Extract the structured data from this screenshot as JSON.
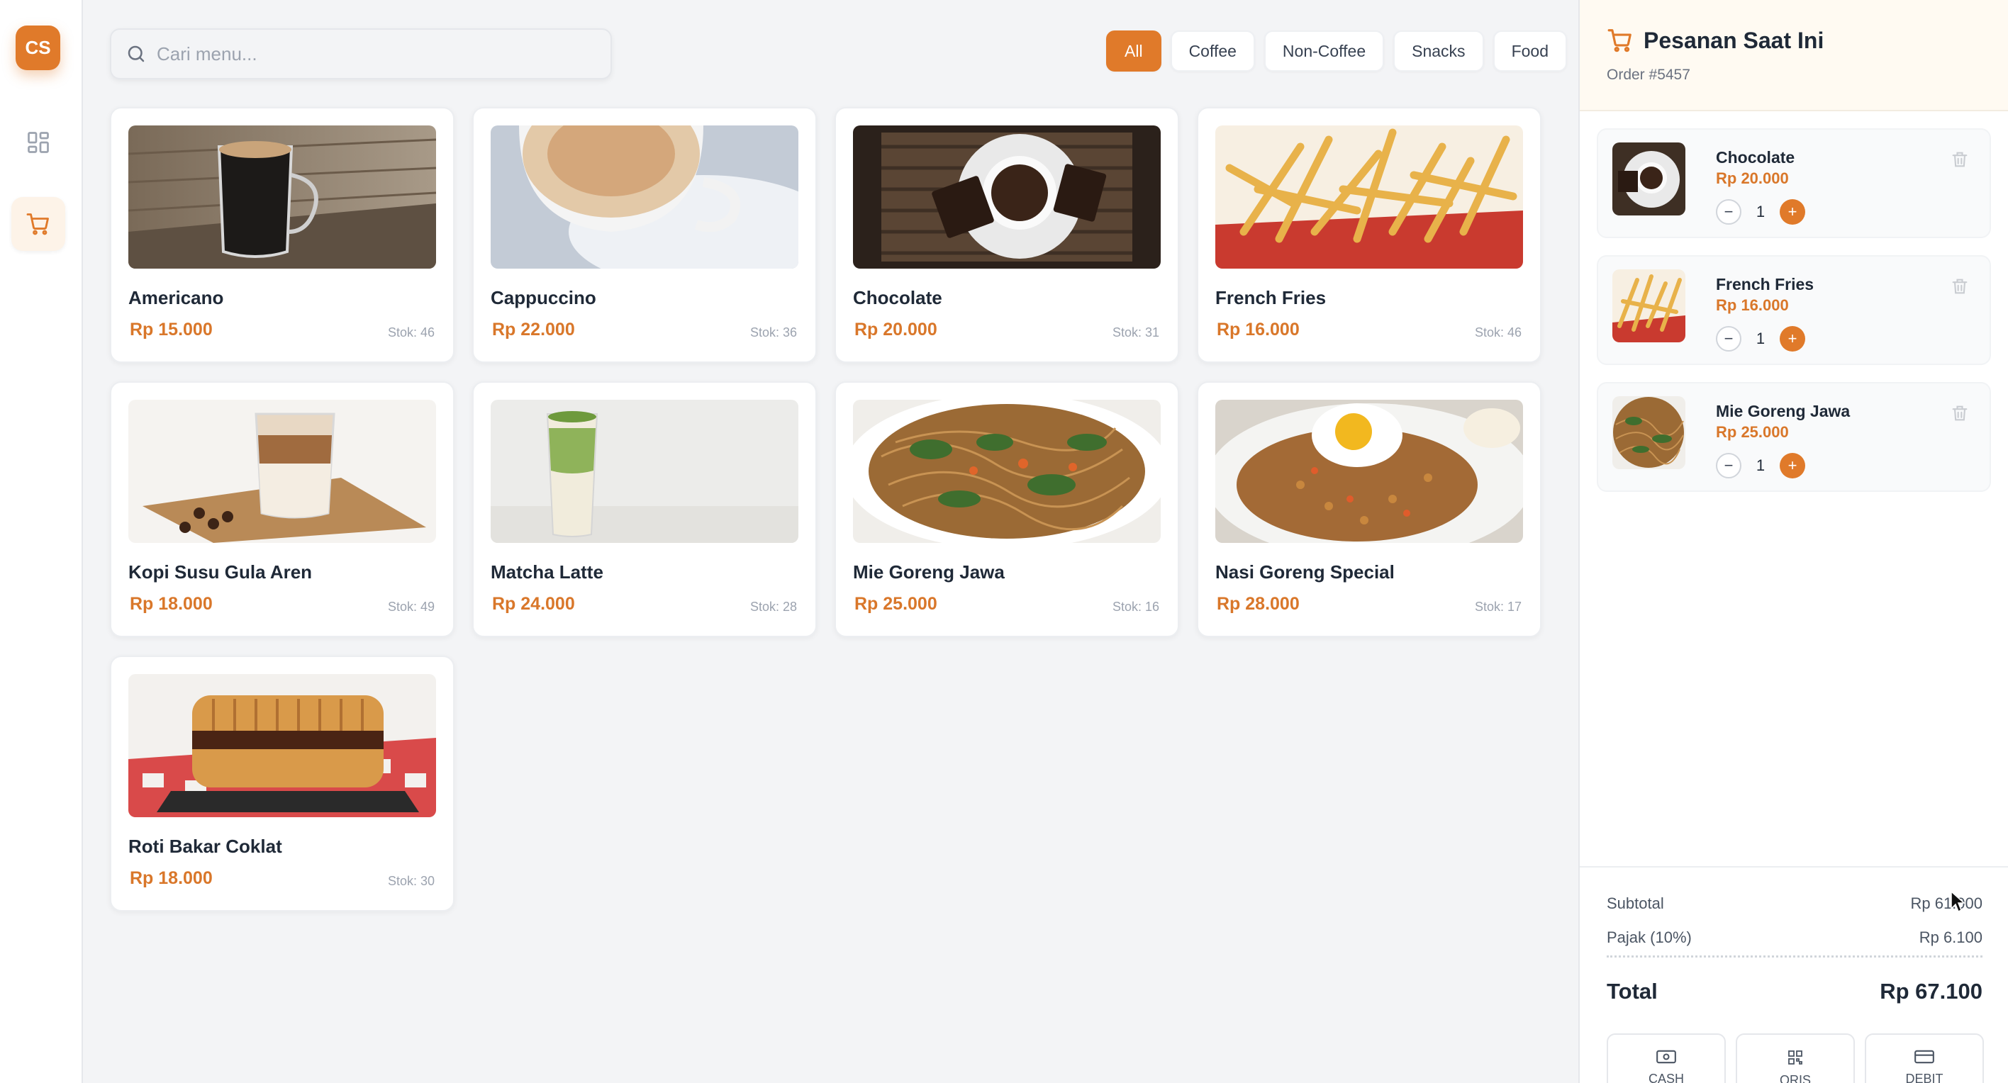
{
  "sidebar": {
    "avatar_initials": "CS",
    "items": [
      {
        "name": "dashboard",
        "icon": "grid-icon"
      },
      {
        "name": "pos",
        "icon": "cart-icon",
        "active": true
      }
    ]
  },
  "search": {
    "placeholder": "Cari menu...",
    "value": ""
  },
  "filters": [
    "All",
    "Coffee",
    "Non-Coffee",
    "Snacks",
    "Food"
  ],
  "active_filter": "All",
  "products": [
    {
      "name": "Americano",
      "price": "Rp 15.000",
      "stock": "Stok: 46"
    },
    {
      "name": "Cappuccino",
      "price": "Rp 22.000",
      "stock": "Stok: 36"
    },
    {
      "name": "Chocolate",
      "price": "Rp 20.000",
      "stock": "Stok: 31"
    },
    {
      "name": "French Fries",
      "price": "Rp 16.000",
      "stock": "Stok: 46"
    },
    {
      "name": "Kopi Susu Gula Aren",
      "price": "Rp 18.000",
      "stock": "Stok: 49"
    },
    {
      "name": "Matcha Latte",
      "price": "Rp 24.000",
      "stock": "Stok: 28"
    },
    {
      "name": "Mie Goreng Jawa",
      "price": "Rp 25.000",
      "stock": "Stok: 16"
    },
    {
      "name": "Nasi Goreng Special",
      "price": "Rp 28.000",
      "stock": "Stok: 17"
    },
    {
      "name": "Roti Bakar Coklat",
      "price": "Rp 18.000",
      "stock": "Stok: 30"
    }
  ],
  "order": {
    "title": "Pesanan Saat Ini",
    "order_number": "Order #5457",
    "items": [
      {
        "name": "Chocolate",
        "price": "Rp 20.000",
        "qty": "1"
      },
      {
        "name": "French Fries",
        "price": "Rp 16.000",
        "qty": "1"
      },
      {
        "name": "Mie Goreng Jawa",
        "price": "Rp 25.000",
        "qty": "1"
      }
    ],
    "subtotal_label": "Subtotal",
    "subtotal_value": "Rp 61.000",
    "tax_label": "Pajak (10%)",
    "tax_value": "Rp 6.100",
    "total_label": "Total",
    "total_value": "Rp 67.100",
    "payment_methods": [
      "CASH",
      "QRIS",
      "DEBIT"
    ]
  },
  "colors": {
    "accent": "#e07a2a",
    "price": "#d9772a",
    "bg": "#f3f4f6"
  }
}
